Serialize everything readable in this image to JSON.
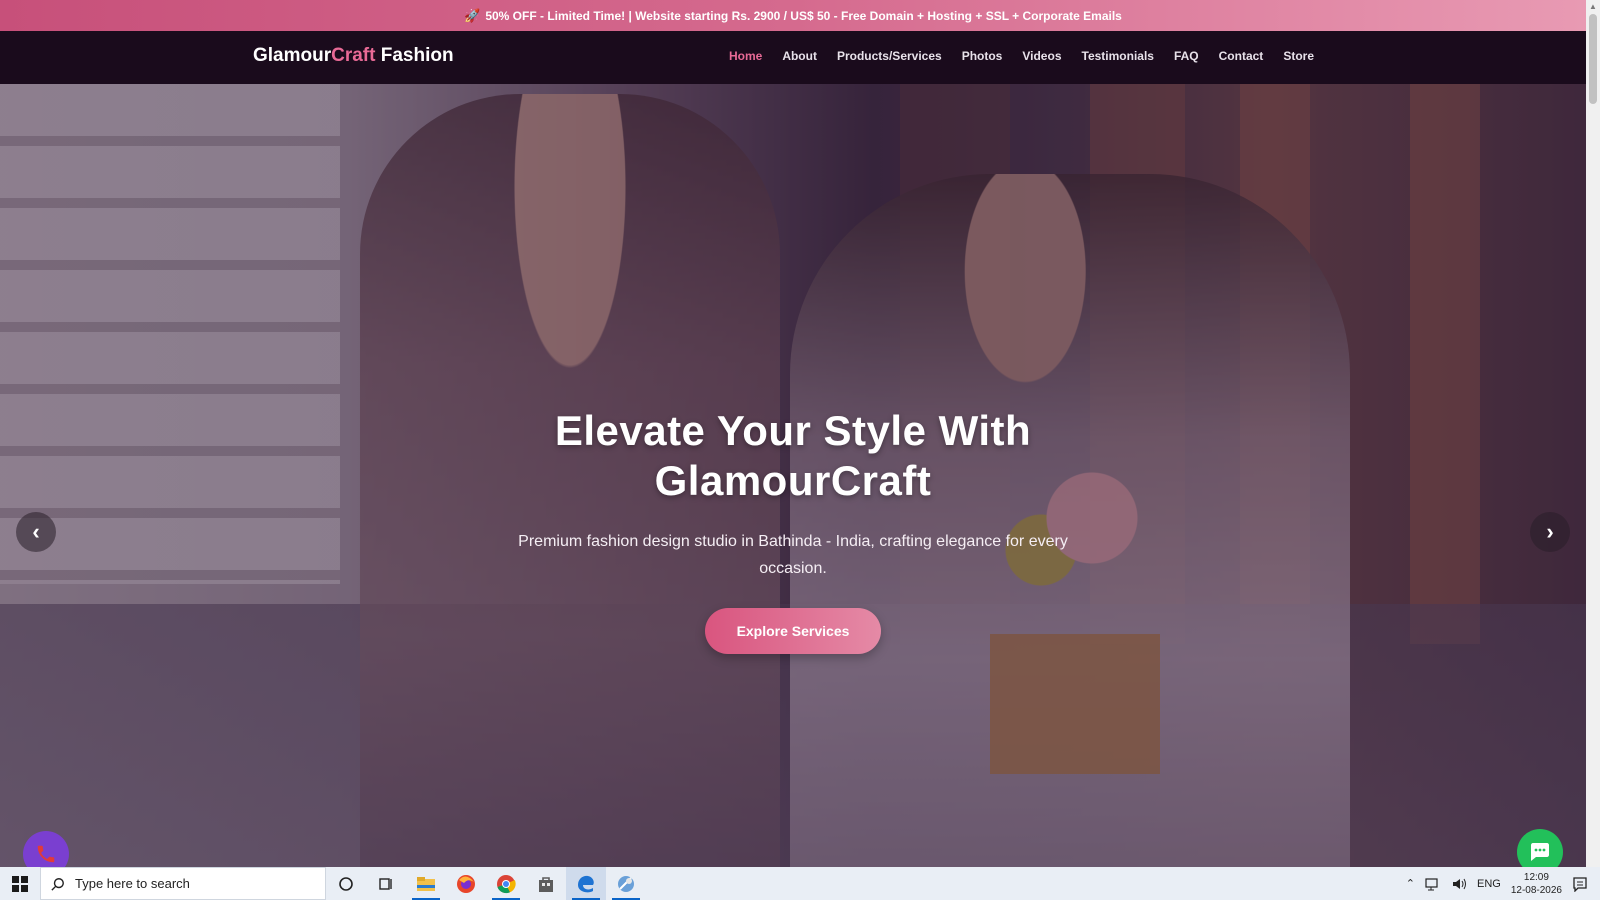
{
  "promo": {
    "icon": "rocket-icon",
    "text": "50% OFF - Limited Time! | Website starting Rs. 2900 / US$ 50 - Free Domain + Hosting + SSL + Corporate Emails"
  },
  "brand": {
    "part1": "Glamour",
    "part2": "Craft",
    "part3": " Fashion",
    "accent_color": "#e86a96"
  },
  "nav": [
    {
      "label": "Home",
      "active": true
    },
    {
      "label": "About"
    },
    {
      "label": "Products/Services"
    },
    {
      "label": "Photos"
    },
    {
      "label": "Videos"
    },
    {
      "label": "Testimonials"
    },
    {
      "label": "FAQ"
    },
    {
      "label": "Contact"
    },
    {
      "label": "Store"
    }
  ],
  "hero": {
    "title": "Elevate Your Style With GlamourCraft",
    "subtitle": "Premium fashion design studio in Bathinda - India, crafting elegance for every occasion.",
    "cta": "Explore Services",
    "prev_icon": "‹",
    "next_icon": "›"
  },
  "floating": {
    "call_icon": "phone-icon",
    "chat_icon": "chat-bubble-icon"
  },
  "taskbar": {
    "search_placeholder": "Type here to search",
    "apps": [
      "cortana-icon",
      "task-view-icon",
      "file-explorer-icon",
      "firefox-icon",
      "chrome-icon",
      "store-icon",
      "edge-icon",
      "app-icon"
    ],
    "lang": "ENG",
    "time": "12:09",
    "date": "12-08-2026"
  }
}
